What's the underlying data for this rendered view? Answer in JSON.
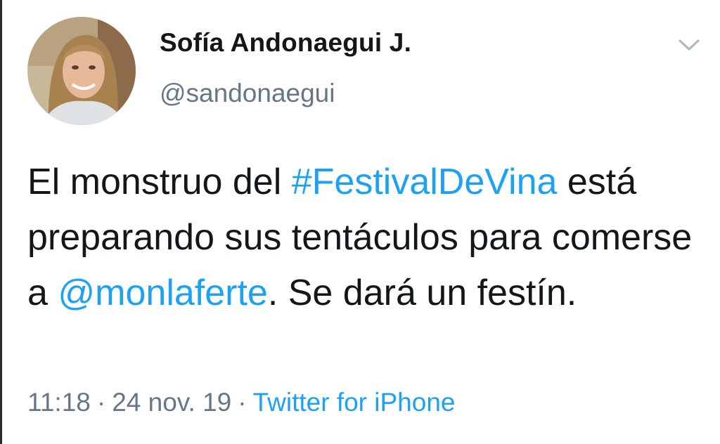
{
  "user": {
    "display_name": "Sofía Andonaegui J.",
    "handle": "@sandonaegui",
    "avatar_icon": "profile-photo"
  },
  "menu": {
    "icon": "chevron-down-icon"
  },
  "tweet": {
    "text_1": "El monstruo del ",
    "hashtag": "#FestivalDeVina",
    "text_2": " está preparando sus tentáculos para comerse a ",
    "mention": "@monlaferte",
    "text_3": ". Se dará un festín."
  },
  "meta": {
    "time": "11:18",
    "separator": "·",
    "date": "24 nov. 19",
    "source": "Twitter for iPhone"
  },
  "colors": {
    "link": "#1da1f2",
    "secondary_text": "#657786",
    "primary_text": "#14171a"
  }
}
